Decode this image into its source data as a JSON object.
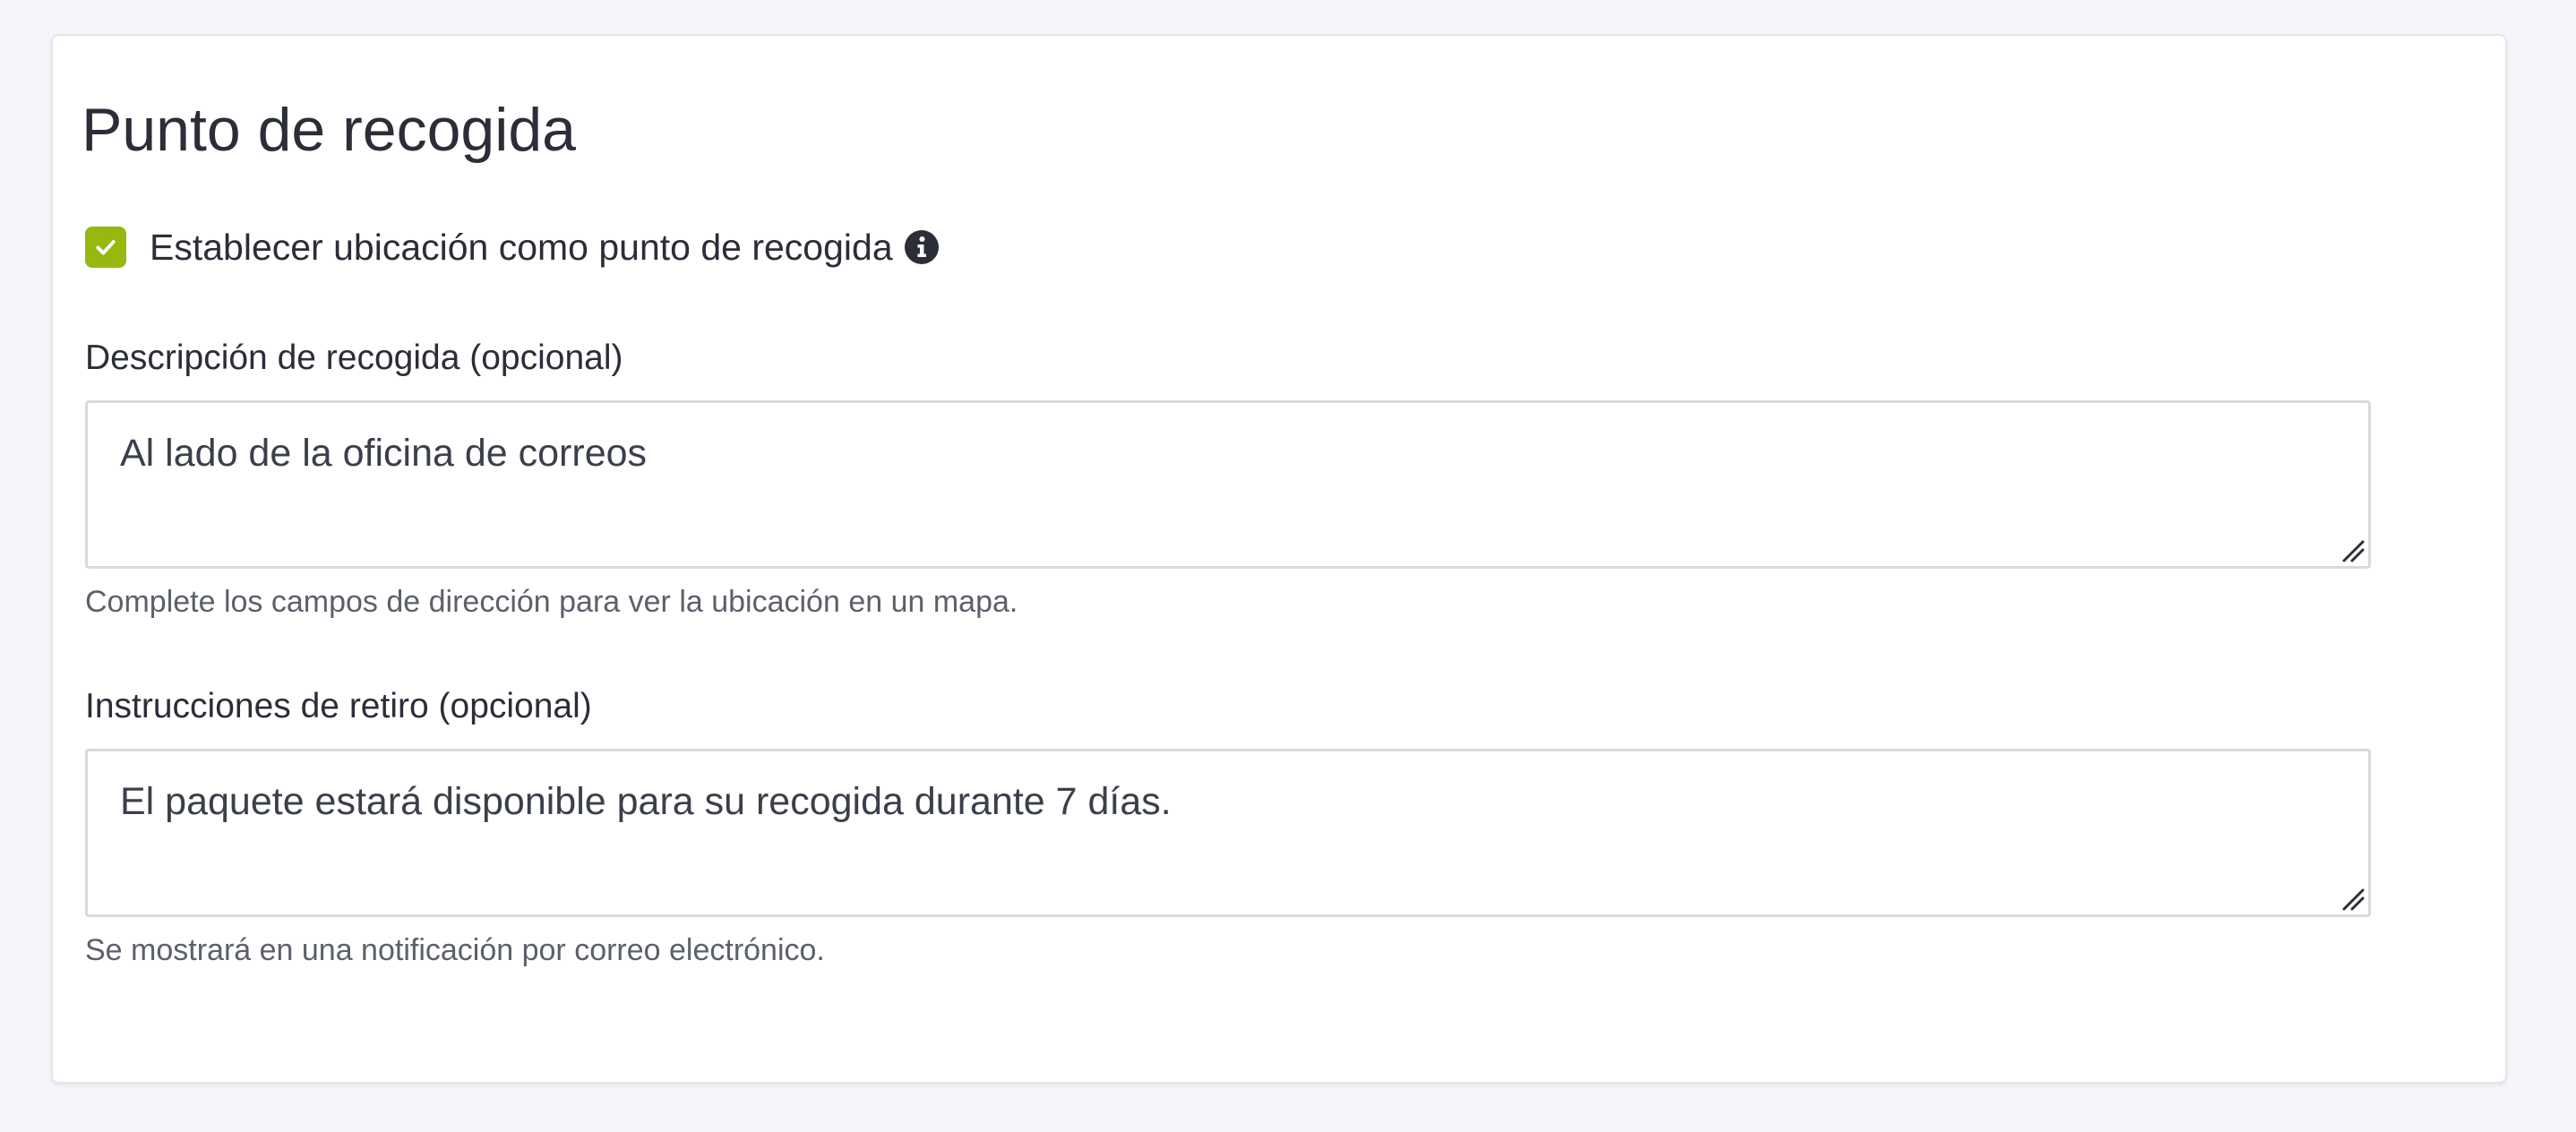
{
  "section": {
    "title": "Punto de recogida"
  },
  "pickup_checkbox": {
    "label": "Establecer ubicación como punto de recogida",
    "checked": true,
    "icon": "check-icon",
    "info_icon": "info-icon",
    "accent_color": "#96b80f"
  },
  "description_field": {
    "label": "Descripción de recogida (opcional)",
    "value": "Al lado de la oficina de correos",
    "help": "Complete los campos de dirección para ver la ubicación en un mapa."
  },
  "instructions_field": {
    "label": "Instrucciones de retiro (opcional)",
    "value": "El paquete estará disponible para su recogida durante 7 días.",
    "help": "Se mostrará en una notificación por correo electrónico."
  }
}
